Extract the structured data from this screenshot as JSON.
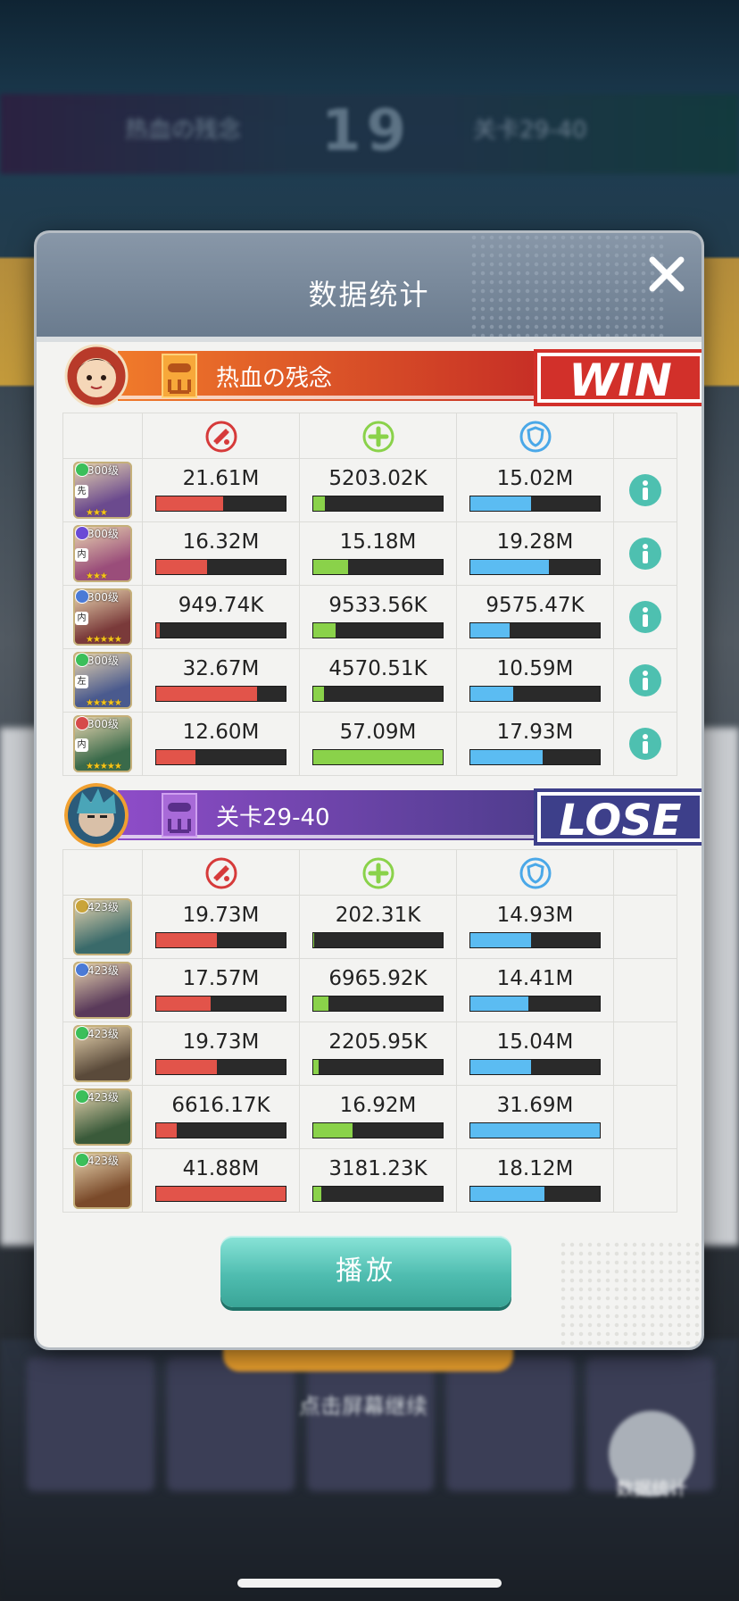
{
  "background": {
    "score": "19",
    "left_name": "热血の残念",
    "right_name": "关卡29-40",
    "hint": "点击屏幕继续",
    "stats_button": "数据统计"
  },
  "dialog": {
    "title": "数据统计",
    "play_label": "播放"
  },
  "colors": {
    "damage": "#e2544a",
    "heal": "#8ad24a",
    "defense": "#5bbcf2",
    "win_banner": "#d2302a",
    "lose_banner": "#4b3c8a"
  },
  "teams": [
    {
      "name": "热血の残念",
      "result": "WIN",
      "heroes": [
        {
          "level": "300级",
          "side": "先",
          "stars": "★★★",
          "gem": "#3bbf5a",
          "portrait": "#6b4a8e",
          "damage": "21.61M",
          "heal": "5203.02K",
          "defense": "15.02M",
          "damage_pct": 52,
          "heal_pct": 9,
          "defense_pct": 47
        },
        {
          "level": "300级",
          "side": "内",
          "stars": "★★★",
          "gem": "#6a4ad6",
          "portrait": "#9a4d7a",
          "damage": "16.32M",
          "heal": "15.18M",
          "defense": "19.28M",
          "damage_pct": 39,
          "heal_pct": 27,
          "defense_pct": 61
        },
        {
          "level": "300级",
          "side": "内",
          "stars": "★★★★★",
          "gem": "#4a7ad6",
          "portrait": "#7a3a3a",
          "damage": "949.74K",
          "heal": "9533.56K",
          "defense": "9575.47K",
          "damage_pct": 3,
          "heal_pct": 17,
          "defense_pct": 30
        },
        {
          "level": "300级",
          "side": "左",
          "stars": "★★★★★",
          "gem": "#3bbf5a",
          "portrait": "#4a5a8e",
          "damage": "32.67M",
          "heal": "4570.51K",
          "defense": "10.59M",
          "damage_pct": 78,
          "heal_pct": 8,
          "defense_pct": 33
        },
        {
          "level": "300级",
          "side": "内",
          "stars": "★★★★★",
          "gem": "#d64a4a",
          "portrait": "#3a6a4a",
          "damage": "12.60M",
          "heal": "57.09M",
          "defense": "17.93M",
          "damage_pct": 30,
          "heal_pct": 100,
          "defense_pct": 56
        }
      ]
    },
    {
      "name": "关卡29-40",
      "result": "LOSE",
      "heroes": [
        {
          "level": "423级",
          "stars": "",
          "gem": "#c9a43a",
          "portrait": "#3a6a6a",
          "damage": "19.73M",
          "heal": "202.31K",
          "defense": "14.93M",
          "damage_pct": 47,
          "heal_pct": 1,
          "defense_pct": 47
        },
        {
          "level": "423级",
          "stars": "",
          "gem": "#4a7ad6",
          "portrait": "#5a3a5a",
          "damage": "17.57M",
          "heal": "6965.92K",
          "defense": "14.41M",
          "damage_pct": 42,
          "heal_pct": 12,
          "defense_pct": 45
        },
        {
          "level": "423级",
          "stars": "",
          "gem": "#3bbf5a",
          "portrait": "#5a4a3a",
          "damage": "19.73M",
          "heal": "2205.95K",
          "defense": "15.04M",
          "damage_pct": 47,
          "heal_pct": 4,
          "defense_pct": 47
        },
        {
          "level": "423级",
          "stars": "",
          "gem": "#3bbf5a",
          "portrait": "#3a5a3a",
          "damage": "6616.17K",
          "heal": "16.92M",
          "defense": "31.69M",
          "damage_pct": 16,
          "heal_pct": 30,
          "defense_pct": 100
        },
        {
          "level": "423级",
          "stars": "",
          "gem": "#3bbf5a",
          "portrait": "#7a4a2a",
          "damage": "41.88M",
          "heal": "3181.23K",
          "defense": "18.12M",
          "damage_pct": 100,
          "heal_pct": 6,
          "defense_pct": 57
        }
      ]
    }
  ]
}
